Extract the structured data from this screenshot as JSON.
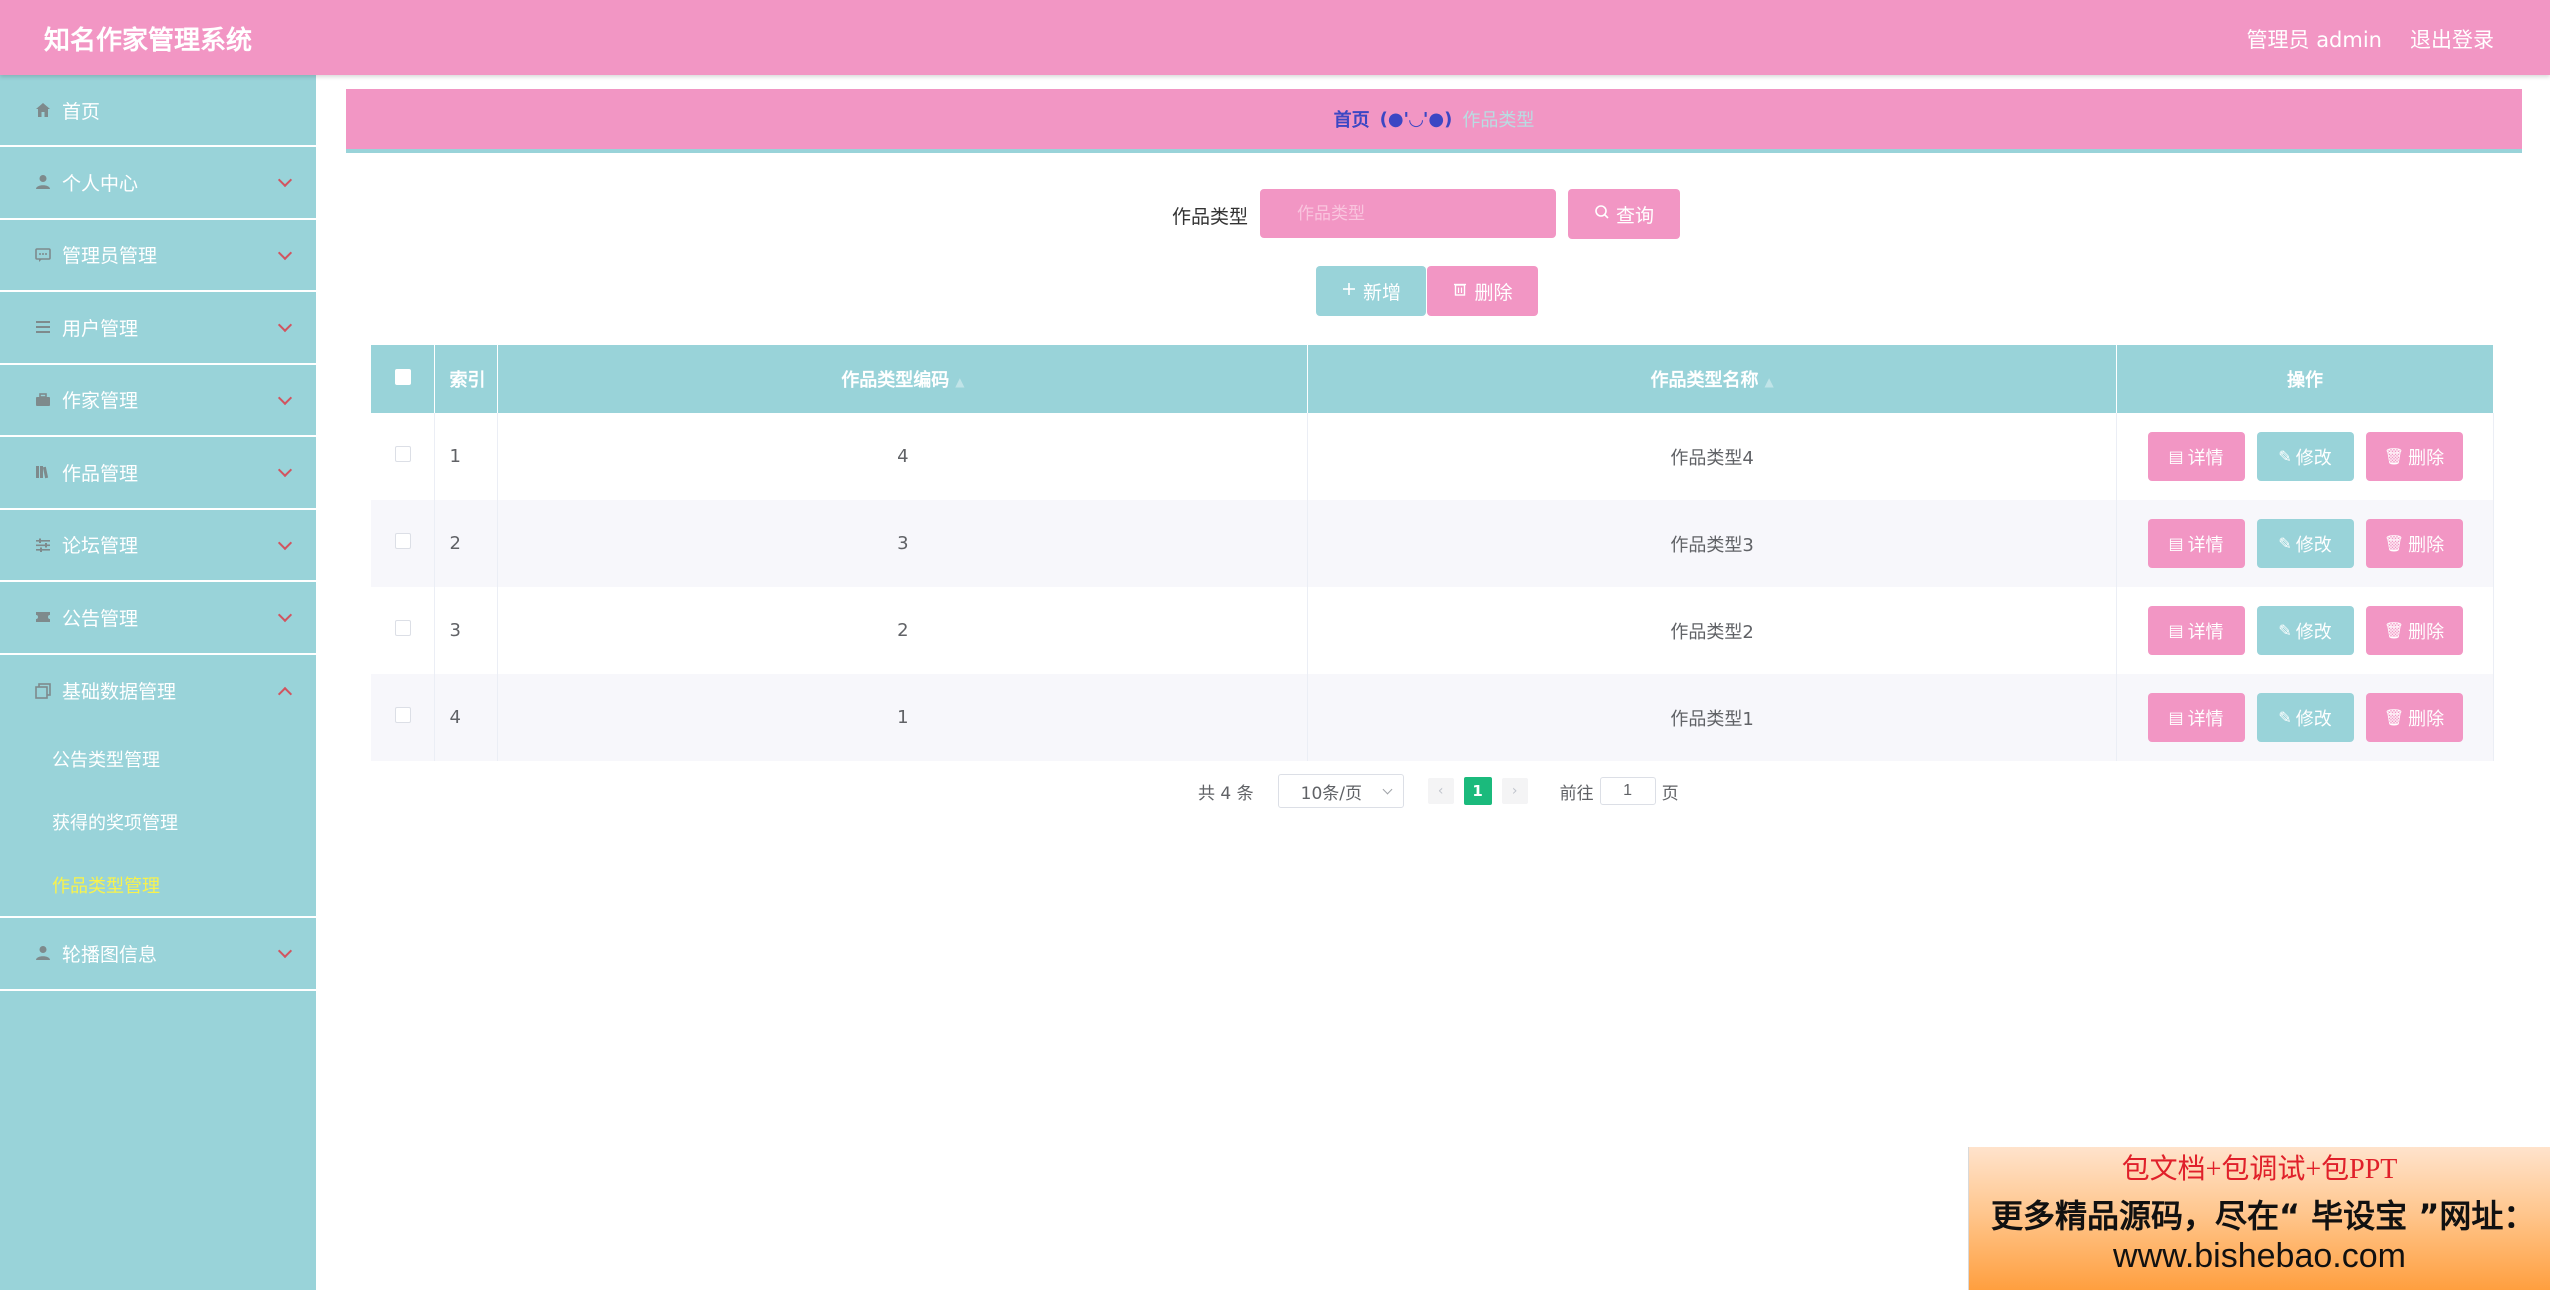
{
  "header": {
    "title": "知名作家管理系统",
    "user": "管理员 admin",
    "logout": "退出登录"
  },
  "sidebar": {
    "items": [
      {
        "label": "首页",
        "icon": "home-icon"
      },
      {
        "label": "个人中心",
        "icon": "person-icon"
      },
      {
        "label": "管理员管理",
        "icon": "chat-icon"
      },
      {
        "label": "用户管理",
        "icon": "list-icon"
      },
      {
        "label": "作家管理",
        "icon": "briefcase-icon"
      },
      {
        "label": "作品管理",
        "icon": "books-icon"
      },
      {
        "label": "论坛管理",
        "icon": "sliders-icon"
      },
      {
        "label": "公告管理",
        "icon": "ticket-icon"
      },
      {
        "label": "基础数据管理",
        "icon": "copy-icon"
      },
      {
        "label": "轮播图信息",
        "icon": "person-icon"
      }
    ],
    "submenu": [
      "公告类型管理",
      "获得的奖项管理",
      "作品类型管理"
    ]
  },
  "breadcrumb": {
    "home": "首页",
    "separator": "(●'◡'●)",
    "current": "作品类型"
  },
  "search": {
    "label": "作品类型",
    "placeholder": "作品类型",
    "query_button": "查询"
  },
  "actions": {
    "add": "新增",
    "delete": "删除"
  },
  "table": {
    "headers": [
      "索引",
      "作品类型编码",
      "作品类型名称",
      "操作"
    ],
    "rows": [
      {
        "index": "1",
        "code": "4",
        "name": "作品类型4"
      },
      {
        "index": "2",
        "code": "3",
        "name": "作品类型3"
      },
      {
        "index": "3",
        "code": "2",
        "name": "作品类型2"
      },
      {
        "index": "4",
        "code": "1",
        "name": "作品类型1"
      }
    ],
    "row_actions": {
      "detail": "详情",
      "edit": "修改",
      "delete": "删除"
    }
  },
  "pagination": {
    "total": "共 4 条",
    "page_size": "10条/页",
    "current_page": "1",
    "goto_prefix": "前往",
    "goto_value": "1",
    "goto_suffix": "页"
  },
  "promo": {
    "line1": "包文档+包调试+包PPT",
    "line2": "更多精品源码，尽在“ 毕设宝 ”网址：",
    "line3": "www.bishebao.com"
  },
  "colors": {
    "pink": "#f296c4",
    "teal": "#99d3d9",
    "active_submenu": "#f8f24c",
    "page_active": "#1bba7c"
  }
}
